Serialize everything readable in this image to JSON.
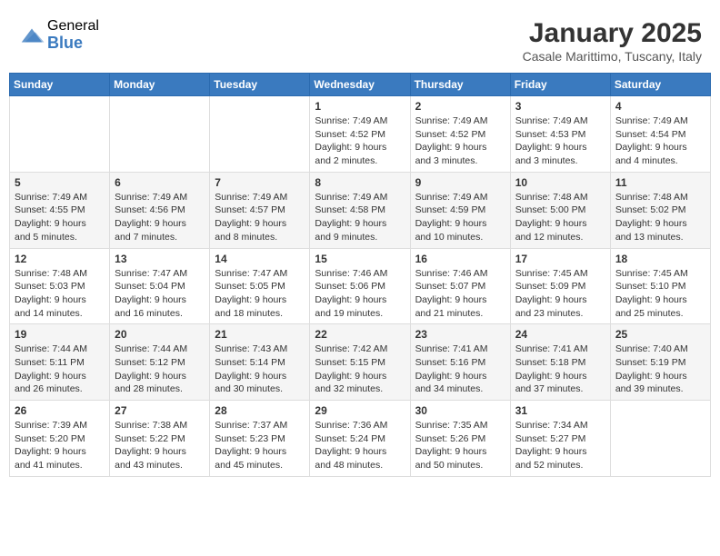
{
  "logo": {
    "general": "General",
    "blue": "Blue"
  },
  "title": "January 2025",
  "location": "Casale Marittimo, Tuscany, Italy",
  "weekdays": [
    "Sunday",
    "Monday",
    "Tuesday",
    "Wednesday",
    "Thursday",
    "Friday",
    "Saturday"
  ],
  "weeks": [
    [
      {
        "day": "",
        "info": ""
      },
      {
        "day": "",
        "info": ""
      },
      {
        "day": "",
        "info": ""
      },
      {
        "day": "1",
        "info": "Sunrise: 7:49 AM\nSunset: 4:52 PM\nDaylight: 9 hours and 2 minutes."
      },
      {
        "day": "2",
        "info": "Sunrise: 7:49 AM\nSunset: 4:52 PM\nDaylight: 9 hours and 3 minutes."
      },
      {
        "day": "3",
        "info": "Sunrise: 7:49 AM\nSunset: 4:53 PM\nDaylight: 9 hours and 3 minutes."
      },
      {
        "day": "4",
        "info": "Sunrise: 7:49 AM\nSunset: 4:54 PM\nDaylight: 9 hours and 4 minutes."
      }
    ],
    [
      {
        "day": "5",
        "info": "Sunrise: 7:49 AM\nSunset: 4:55 PM\nDaylight: 9 hours and 5 minutes."
      },
      {
        "day": "6",
        "info": "Sunrise: 7:49 AM\nSunset: 4:56 PM\nDaylight: 9 hours and 7 minutes."
      },
      {
        "day": "7",
        "info": "Sunrise: 7:49 AM\nSunset: 4:57 PM\nDaylight: 9 hours and 8 minutes."
      },
      {
        "day": "8",
        "info": "Sunrise: 7:49 AM\nSunset: 4:58 PM\nDaylight: 9 hours and 9 minutes."
      },
      {
        "day": "9",
        "info": "Sunrise: 7:49 AM\nSunset: 4:59 PM\nDaylight: 9 hours and 10 minutes."
      },
      {
        "day": "10",
        "info": "Sunrise: 7:48 AM\nSunset: 5:00 PM\nDaylight: 9 hours and 12 minutes."
      },
      {
        "day": "11",
        "info": "Sunrise: 7:48 AM\nSunset: 5:02 PM\nDaylight: 9 hours and 13 minutes."
      }
    ],
    [
      {
        "day": "12",
        "info": "Sunrise: 7:48 AM\nSunset: 5:03 PM\nDaylight: 9 hours and 14 minutes."
      },
      {
        "day": "13",
        "info": "Sunrise: 7:47 AM\nSunset: 5:04 PM\nDaylight: 9 hours and 16 minutes."
      },
      {
        "day": "14",
        "info": "Sunrise: 7:47 AM\nSunset: 5:05 PM\nDaylight: 9 hours and 18 minutes."
      },
      {
        "day": "15",
        "info": "Sunrise: 7:46 AM\nSunset: 5:06 PM\nDaylight: 9 hours and 19 minutes."
      },
      {
        "day": "16",
        "info": "Sunrise: 7:46 AM\nSunset: 5:07 PM\nDaylight: 9 hours and 21 minutes."
      },
      {
        "day": "17",
        "info": "Sunrise: 7:45 AM\nSunset: 5:09 PM\nDaylight: 9 hours and 23 minutes."
      },
      {
        "day": "18",
        "info": "Sunrise: 7:45 AM\nSunset: 5:10 PM\nDaylight: 9 hours and 25 minutes."
      }
    ],
    [
      {
        "day": "19",
        "info": "Sunrise: 7:44 AM\nSunset: 5:11 PM\nDaylight: 9 hours and 26 minutes."
      },
      {
        "day": "20",
        "info": "Sunrise: 7:44 AM\nSunset: 5:12 PM\nDaylight: 9 hours and 28 minutes."
      },
      {
        "day": "21",
        "info": "Sunrise: 7:43 AM\nSunset: 5:14 PM\nDaylight: 9 hours and 30 minutes."
      },
      {
        "day": "22",
        "info": "Sunrise: 7:42 AM\nSunset: 5:15 PM\nDaylight: 9 hours and 32 minutes."
      },
      {
        "day": "23",
        "info": "Sunrise: 7:41 AM\nSunset: 5:16 PM\nDaylight: 9 hours and 34 minutes."
      },
      {
        "day": "24",
        "info": "Sunrise: 7:41 AM\nSunset: 5:18 PM\nDaylight: 9 hours and 37 minutes."
      },
      {
        "day": "25",
        "info": "Sunrise: 7:40 AM\nSunset: 5:19 PM\nDaylight: 9 hours and 39 minutes."
      }
    ],
    [
      {
        "day": "26",
        "info": "Sunrise: 7:39 AM\nSunset: 5:20 PM\nDaylight: 9 hours and 41 minutes."
      },
      {
        "day": "27",
        "info": "Sunrise: 7:38 AM\nSunset: 5:22 PM\nDaylight: 9 hours and 43 minutes."
      },
      {
        "day": "28",
        "info": "Sunrise: 7:37 AM\nSunset: 5:23 PM\nDaylight: 9 hours and 45 minutes."
      },
      {
        "day": "29",
        "info": "Sunrise: 7:36 AM\nSunset: 5:24 PM\nDaylight: 9 hours and 48 minutes."
      },
      {
        "day": "30",
        "info": "Sunrise: 7:35 AM\nSunset: 5:26 PM\nDaylight: 9 hours and 50 minutes."
      },
      {
        "day": "31",
        "info": "Sunrise: 7:34 AM\nSunset: 5:27 PM\nDaylight: 9 hours and 52 minutes."
      },
      {
        "day": "",
        "info": ""
      }
    ]
  ]
}
